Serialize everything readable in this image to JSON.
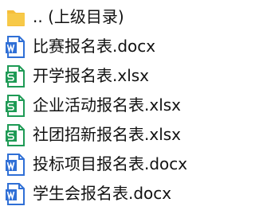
{
  "files": [
    {
      "name": ".. (上级目录)",
      "icon": "folder-icon"
    },
    {
      "name": "比赛报名表.docx",
      "icon": "word-doc-icon"
    },
    {
      "name": "开学报名表.xlsx",
      "icon": "excel-sheet-icon"
    },
    {
      "name": "企业活动报名表.xlsx",
      "icon": "excel-sheet-icon"
    },
    {
      "name": "社团招新报名表.xlsx",
      "icon": "excel-sheet-icon"
    },
    {
      "name": "投标项目报名表.docx",
      "icon": "word-doc-icon"
    },
    {
      "name": "学生会报名表.docx",
      "icon": "word-doc-icon"
    }
  ],
  "colors": {
    "folder": "#F5BE3A",
    "word": "#2F6FD6",
    "excel": "#1E9A55"
  }
}
